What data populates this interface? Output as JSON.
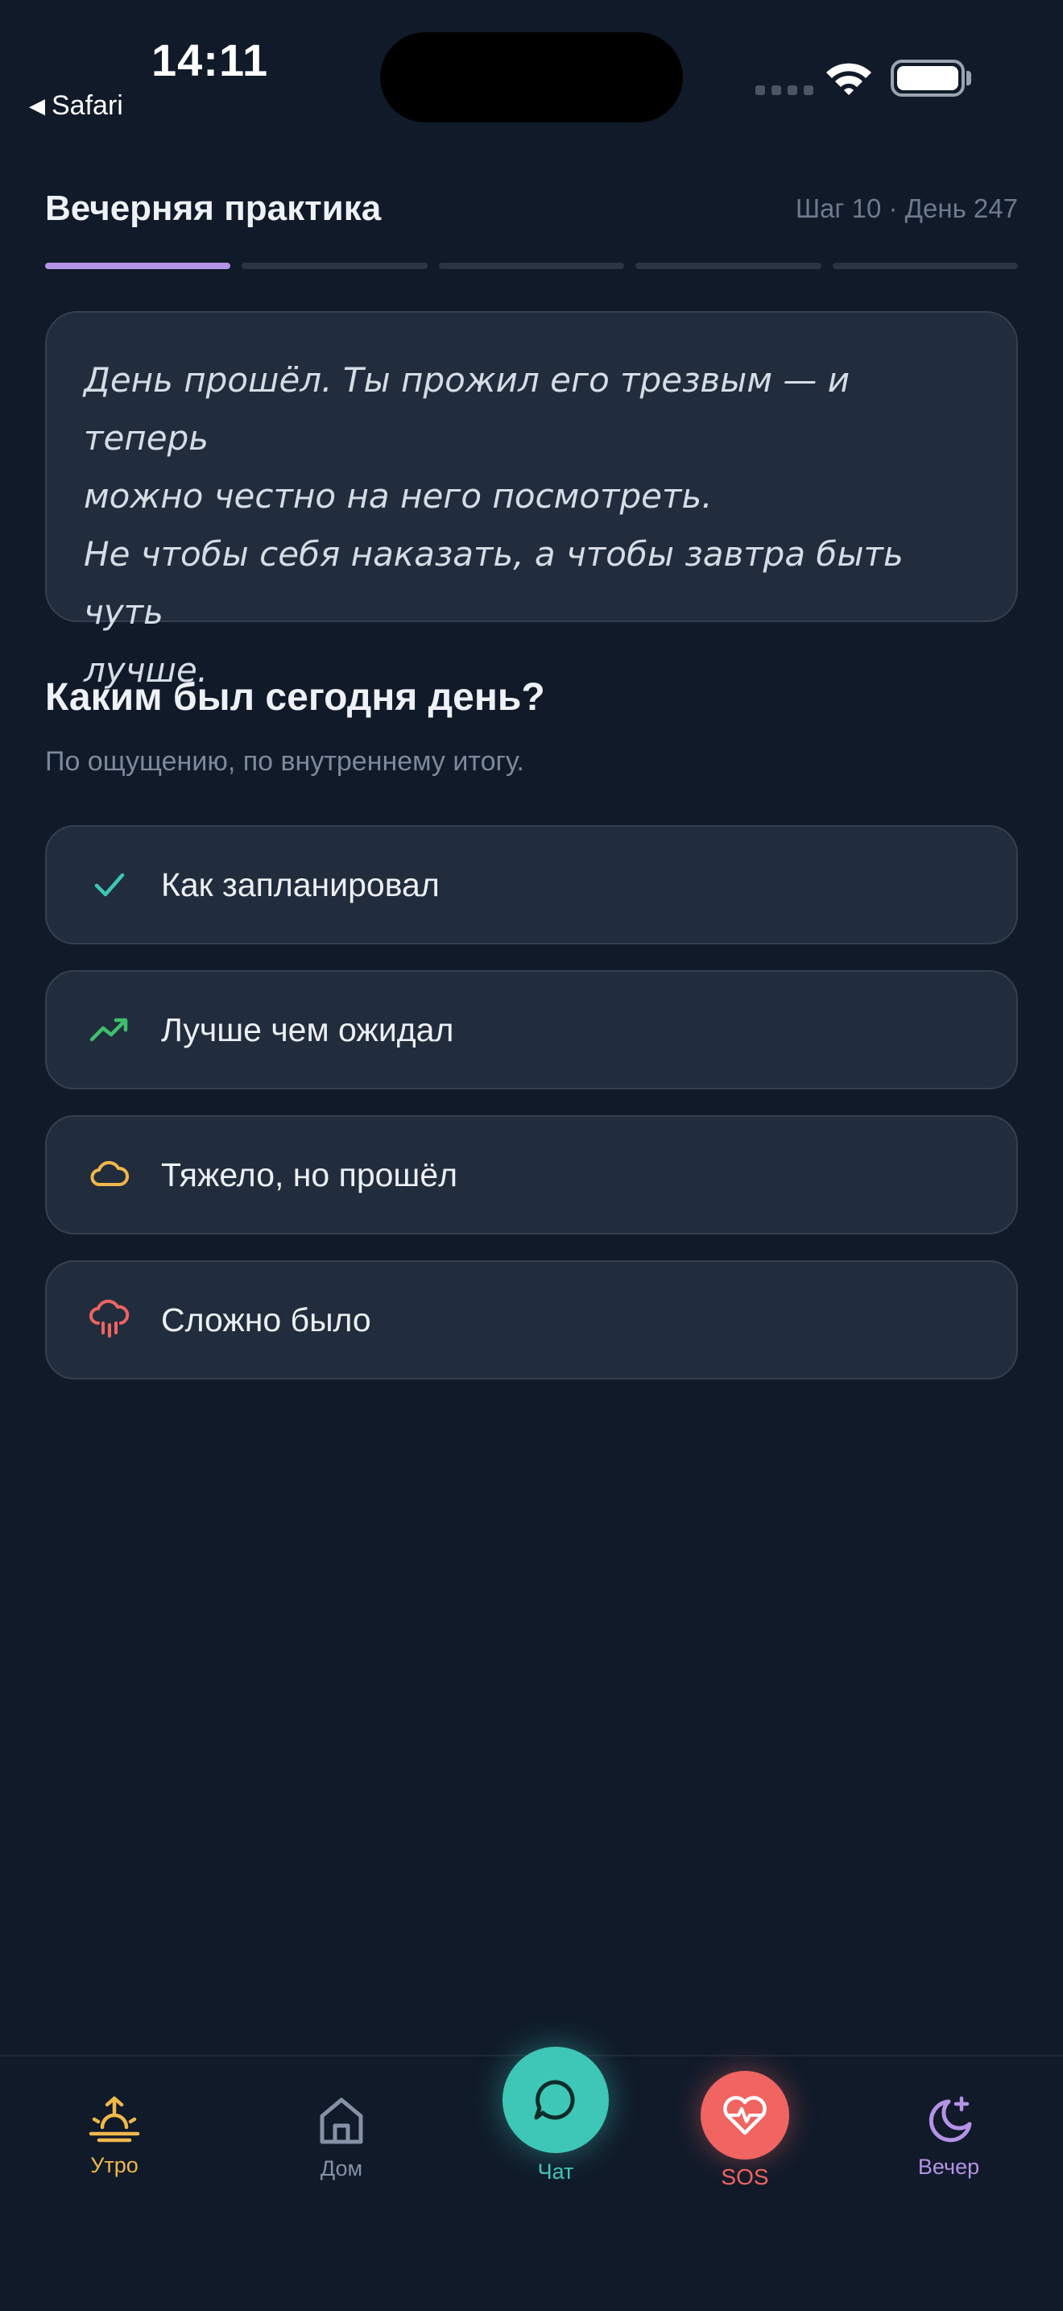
{
  "status_bar": {
    "time": "14:11",
    "back_app": "Safari"
  },
  "header": {
    "title": "Вечерняя практика",
    "step_info": "Шаг 10 · День 247",
    "progress_segments_total": 5,
    "progress_segments_active": 1
  },
  "quote": {
    "lines": [
      "День прошёл. Ты прожил его трезвым — и теперь",
      "можно честно на него посмотреть.",
      "Не чтобы себя наказать, а чтобы завтра быть чуть",
      "лучше."
    ]
  },
  "question": {
    "title": "Каким был сегодня день?",
    "hint": "По ощущению, по внутреннему итогу."
  },
  "options": [
    {
      "label": "Как запланировал",
      "icon": "check-icon",
      "color": "#3ec7b6"
    },
    {
      "label": "Лучше чем ожидал",
      "icon": "trending-up-icon",
      "color": "#3fbf6a"
    },
    {
      "label": "Тяжело, но прошёл",
      "icon": "cloud-icon",
      "color": "#f0b84a"
    },
    {
      "label": "Сложно было",
      "icon": "cloud-rain-icon",
      "color": "#f06462"
    }
  ],
  "tabbar": {
    "morning": {
      "label": "Утро",
      "icon": "sunrise-icon",
      "color": "#f0b84a"
    },
    "home": {
      "label": "Дом",
      "icon": "home-icon",
      "color": "#8592a5"
    },
    "chat": {
      "label": "Чат",
      "icon": "chat-bubble-icon",
      "color": "#3ec7b6"
    },
    "sos": {
      "label": "SOS",
      "icon": "heart-pulse-icon",
      "color": "#f06462"
    },
    "evening": {
      "label": "Вечер",
      "icon": "moon-star-icon",
      "color": "#b493e6"
    }
  }
}
